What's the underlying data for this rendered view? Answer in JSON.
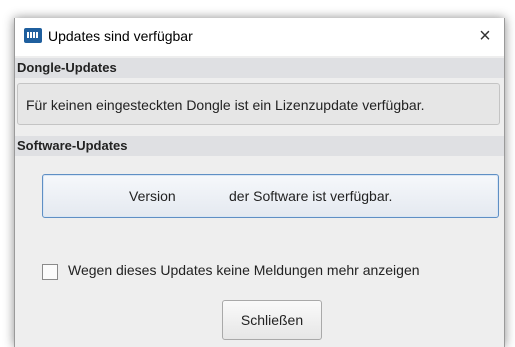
{
  "window": {
    "title": "Updates sind verfügbar",
    "close_glyph": "×",
    "app_icon": "app-logo-icon"
  },
  "dongle_section": {
    "header": "Dongle-Updates",
    "message": "Für keinen eingesteckten Dongle ist ein Lizenzupdate verfügbar."
  },
  "software_section": {
    "header": "Software-Updates",
    "version_word": "Version",
    "version_rest": "der Software ist verfügbar."
  },
  "option": {
    "checked": false,
    "label": "Wegen dieses Updates keine Meldungen mehr anzeigen"
  },
  "actions": {
    "close_label": "Schließen"
  },
  "colors": {
    "accent_border": "#5f8fc4",
    "section_header_bg": "#dfe0e3",
    "dialog_bg": "#eeeeee"
  }
}
